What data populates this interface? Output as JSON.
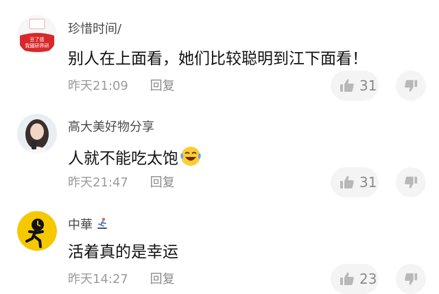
{
  "comments": [
    {
      "username": "珍惜时间/",
      "text": "别人在上面看，她们比较聪明到江下面看！",
      "time": "昨天21:09",
      "reply_label": "回复",
      "likes": "31",
      "avatar_badge_text": "豆了德 我國研界研",
      "avatar": "avatar-red-flag-icon"
    },
    {
      "username": "高大美好物分享",
      "text": "人就不能吃太饱",
      "emoji": "laughing-crying-emoji",
      "time": "昨天21:47",
      "reply_label": "回复",
      "likes": "31",
      "avatar": "avatar-woman-photo"
    },
    {
      "username": "中華",
      "username_badge": "skateboarder-badge-icon",
      "text": "活着真的是幸运",
      "time": "昨天14:27",
      "reply_label": "回复",
      "likes": "23",
      "avatar": "avatar-running-clock-icon"
    }
  ],
  "colors": {
    "username": "#4a4a4a",
    "text": "#111111",
    "meta": "#9a9a9a",
    "button_bg": "#f4f4f4",
    "icon": "#b8b8b8",
    "avatar_red": "#d8282b",
    "avatar_yellow": "#f5c800"
  }
}
